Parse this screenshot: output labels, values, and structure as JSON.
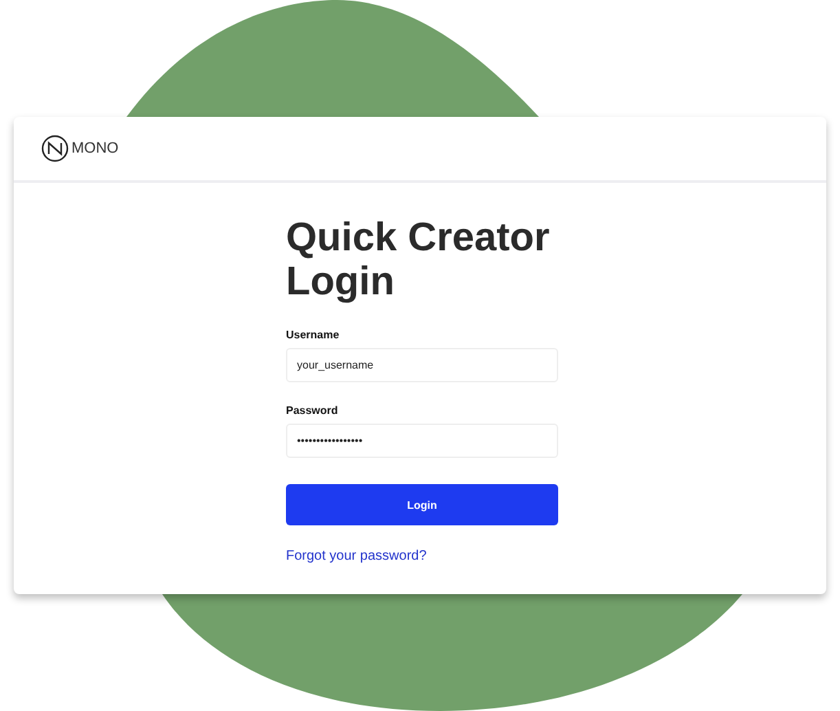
{
  "brand": {
    "name": "MONO"
  },
  "title": "Quick Creator Login",
  "fields": [
    {
      "label": "Username",
      "value": "your_username"
    },
    {
      "label": "Password",
      "value": "•••••••••••••••••"
    }
  ],
  "button": "Login",
  "link": "Forgot your password?"
}
